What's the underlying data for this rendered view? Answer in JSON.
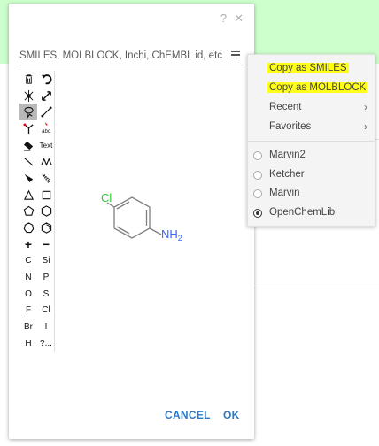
{
  "dialog": {
    "help_glyph": "?",
    "close_glyph": "✕",
    "input_placeholder": "SMILES, MOLBLOCK, Inchi, ChEMBL id, etc",
    "cancel_label": "CANCEL",
    "ok_label": "OK"
  },
  "toolbar": {
    "text_tool_label": "Text",
    "abc_label": "abc",
    "elements": [
      "C",
      "Si",
      "N",
      "P",
      "O",
      "S",
      "F",
      "Cl",
      "Br",
      "I",
      "H",
      "?..."
    ]
  },
  "molecule": {
    "cl_label": "Cl",
    "nh_label": "NH",
    "nh_subscript": "2",
    "cl_color": "#33cc33",
    "n_color": "#3366ff"
  },
  "menu": {
    "copy_smiles": "Copy as SMILES",
    "copy_molblock": "Copy as MOLBLOCK",
    "recent": "Recent",
    "favorites": "Favorites",
    "chevron": "›",
    "editors": [
      {
        "label": "Marvin2",
        "selected": false
      },
      {
        "label": "Ketcher",
        "selected": false
      },
      {
        "label": "Marvin",
        "selected": false
      },
      {
        "label": "OpenChemLib",
        "selected": true
      }
    ],
    "highlight_color": "#ffff1a"
  }
}
